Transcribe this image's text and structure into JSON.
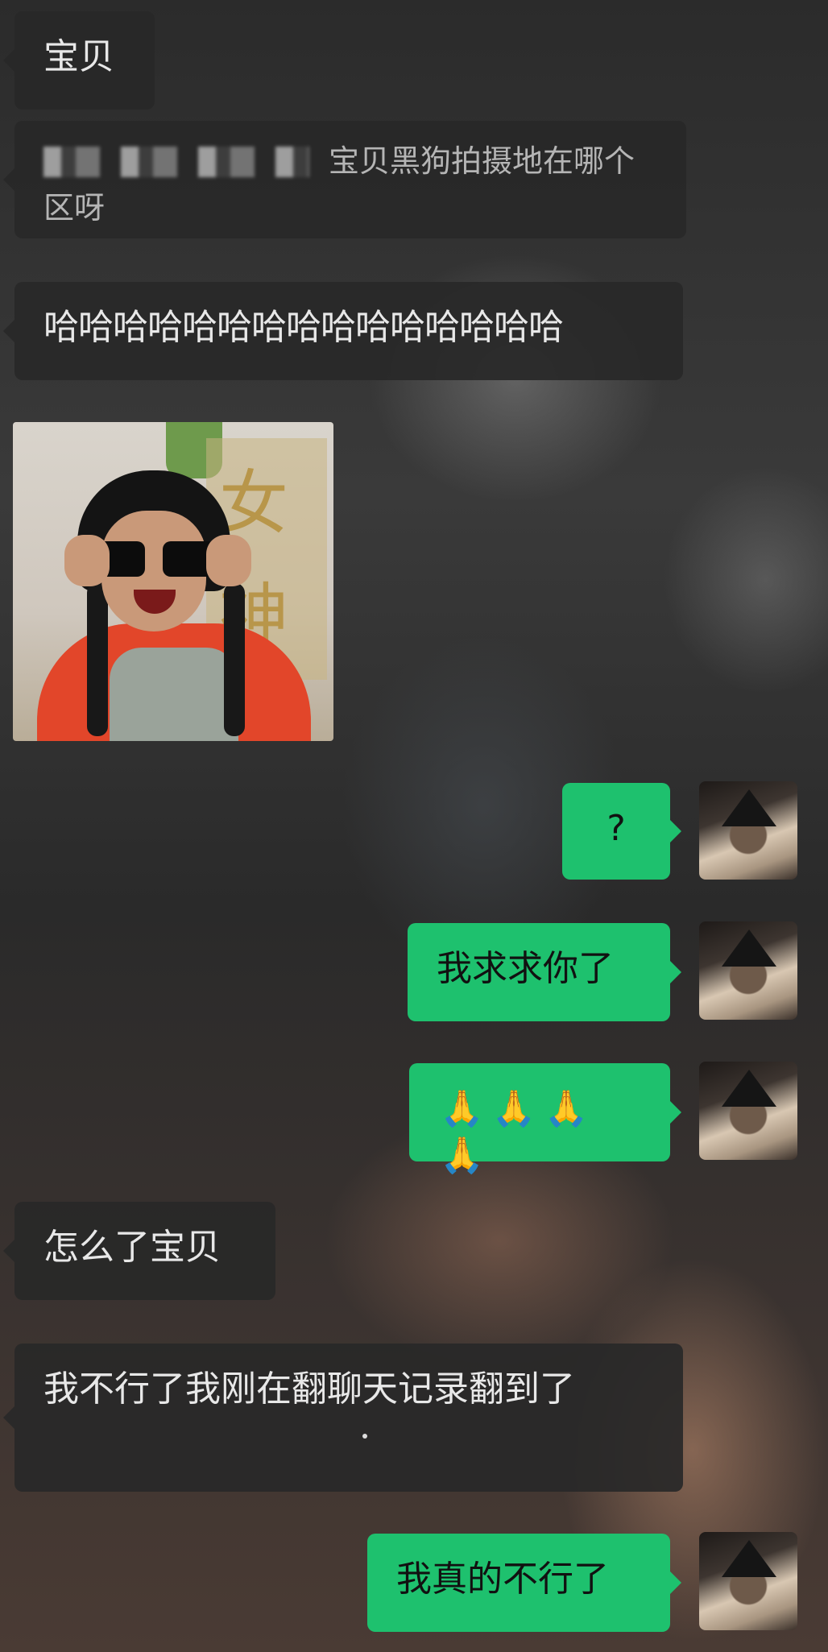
{
  "messages": [
    {
      "side": "in",
      "text": "宝贝"
    },
    {
      "side": "in",
      "quote": "宝贝黑狗拍摄地在哪个区呀"
    },
    {
      "side": "in",
      "text": "哈哈哈哈哈哈哈哈哈哈哈哈哈哈哈"
    },
    {
      "side": "in",
      "sticker": "sunglasses-girl-sticker"
    },
    {
      "side": "out",
      "text": "?"
    },
    {
      "side": "out",
      "text": "我求求你了"
    },
    {
      "side": "out",
      "text": "🙏🙏🙏🙏"
    },
    {
      "side": "in",
      "text": "怎么了宝贝"
    },
    {
      "side": "in",
      "text": "我不行了我刚在翻聊天记录翻到了"
    },
    {
      "side": "out",
      "text": "我真的不行了"
    }
  ],
  "sticker_sign_text": "女神",
  "colors": {
    "outgoing_bubble": "#1ec16e",
    "incoming_bubble": "#282828"
  },
  "icons": {
    "avatar": "self-avatar-cat-hat"
  }
}
